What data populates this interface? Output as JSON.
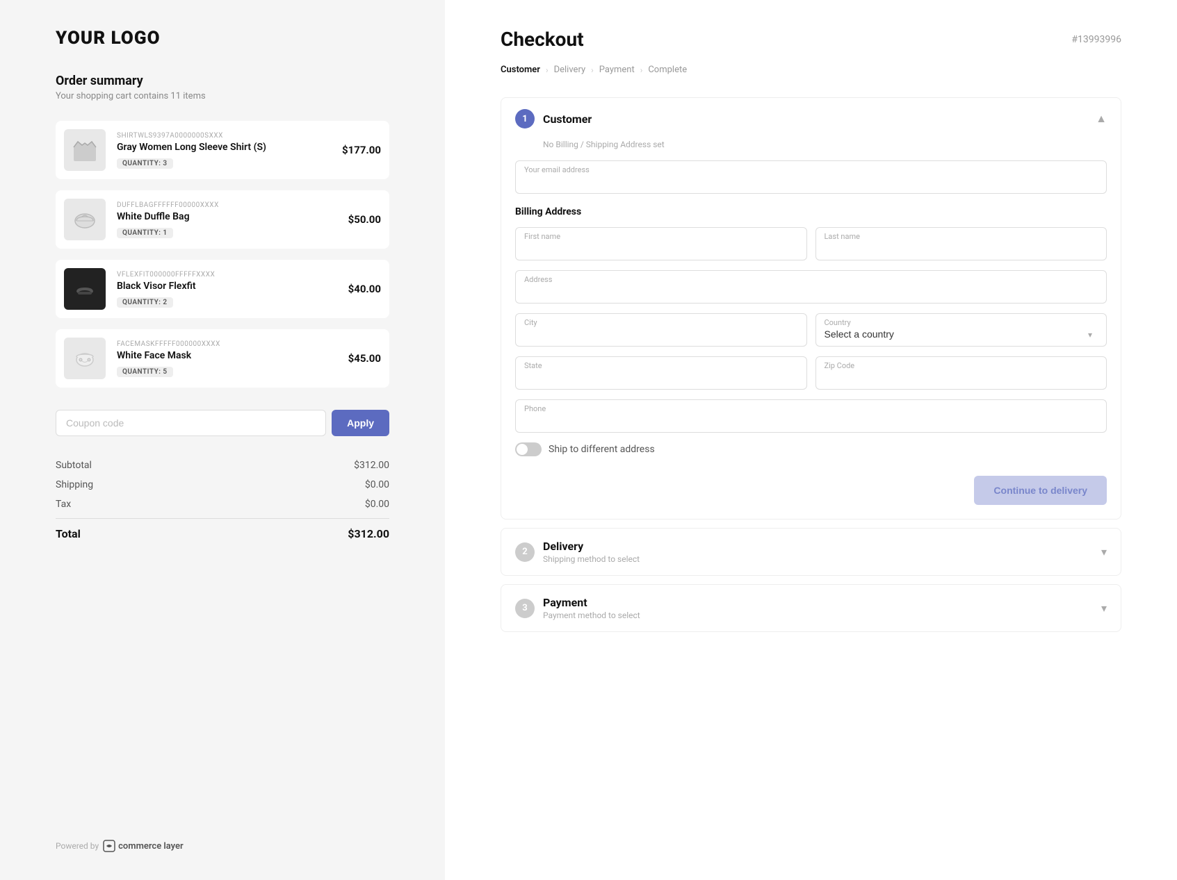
{
  "left": {
    "logo": "YOUR LOGO",
    "order_summary_title": "Order summary",
    "order_summary_subtitle": "Your shopping cart contains 11 items",
    "items": [
      {
        "sku": "SHIRTWLS9397A0000000SXXX",
        "name": "Gray Women Long Sleeve Shirt (S)",
        "quantity": "QUANTITY: 3",
        "price": "$177.00",
        "icon": "shirt"
      },
      {
        "sku": "DUFFLBAGFFFFFF00000XXXX",
        "name": "White Duffle Bag",
        "quantity": "QUANTITY: 1",
        "price": "$50.00",
        "icon": "bag"
      },
      {
        "sku": "VFLEXFIT000000FFFFFXXXX",
        "name": "Black Visor Flexfit",
        "quantity": "QUANTITY: 2",
        "price": "$40.00",
        "icon": "visor"
      },
      {
        "sku": "FACEMASKFFFFF000000XXXX",
        "name": "White Face Mask",
        "quantity": "QUANTITY: 5",
        "price": "$45.00",
        "icon": "mask"
      }
    ],
    "coupon_placeholder": "Coupon code",
    "apply_label": "Apply",
    "subtotal_label": "Subtotal",
    "subtotal_value": "$312.00",
    "shipping_label": "Shipping",
    "shipping_value": "$0.00",
    "tax_label": "Tax",
    "tax_value": "$0.00",
    "total_label": "Total",
    "total_value": "$312.00",
    "powered_by": "Powered by",
    "powered_by_brand": "commerce layer"
  },
  "right": {
    "checkout_title": "Checkout",
    "order_number": "#13993996",
    "breadcrumb": [
      {
        "label": "Customer",
        "active": true
      },
      {
        "label": "Delivery",
        "active": false
      },
      {
        "label": "Payment",
        "active": false
      },
      {
        "label": "Complete",
        "active": false
      }
    ],
    "steps": [
      {
        "number": "1",
        "label": "Customer",
        "sublabel": "No Billing / Shipping Address set",
        "active": true,
        "expanded": true
      },
      {
        "number": "2",
        "label": "Delivery",
        "sublabel": "Shipping method to select",
        "active": false,
        "expanded": false
      },
      {
        "number": "3",
        "label": "Payment",
        "sublabel": "Payment method to select",
        "active": false,
        "expanded": false
      }
    ],
    "form": {
      "email_label": "Your email address",
      "billing_address_label": "Billing Address",
      "first_name_label": "First name",
      "last_name_label": "Last name",
      "address_label": "Address",
      "city_label": "City",
      "country_label": "Country",
      "country_placeholder": "Select a country",
      "state_label": "State",
      "zip_label": "Zip Code",
      "phone_label": "Phone",
      "ship_to_different": "Ship to different address",
      "continue_btn": "Continue to delivery"
    }
  }
}
